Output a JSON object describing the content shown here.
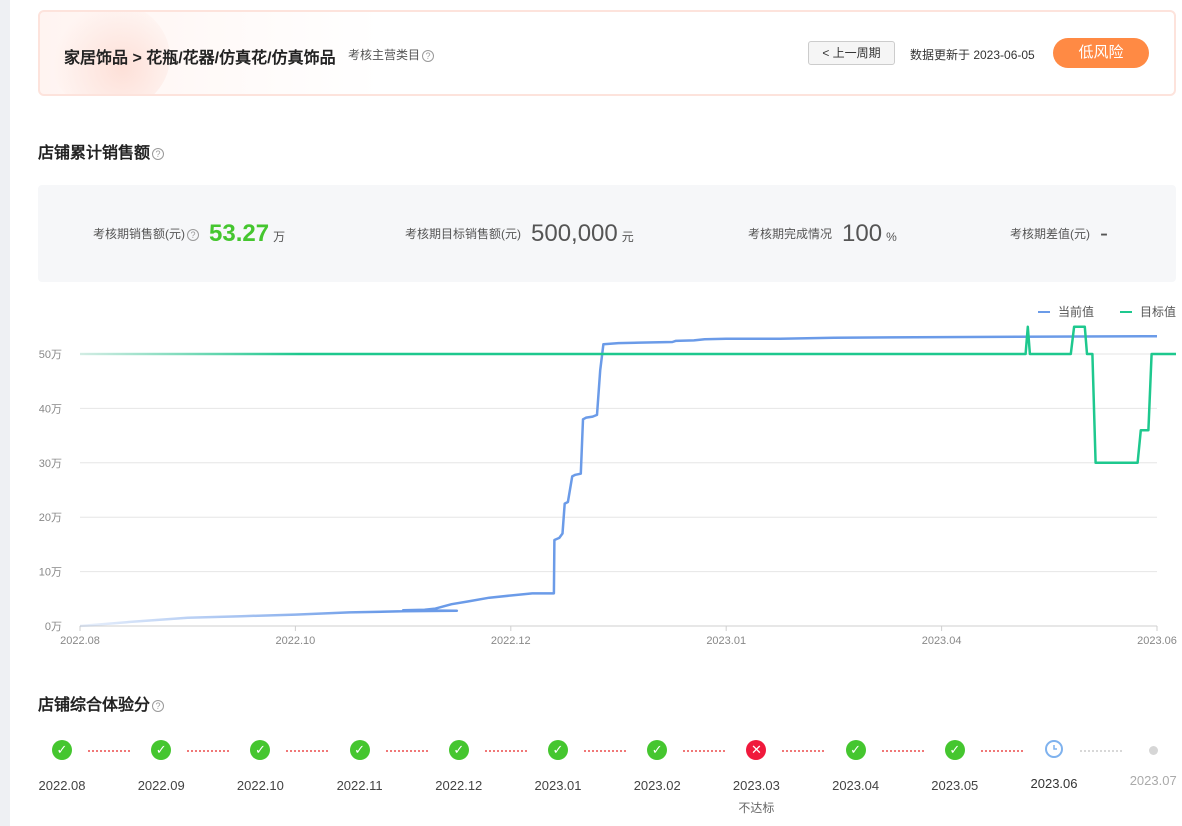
{
  "header": {
    "breadcrumb": "家居饰品 > 花瓶/花器/仿真花/仿真饰品",
    "category_note": "考核主营类目",
    "prev_button": "< 上一周期",
    "update_text": "数据更新于 2023-06-05",
    "risk_badge": "低风险",
    "risk_color": "#ff8a44"
  },
  "sales_section": {
    "title": "店铺累计销售额"
  },
  "stats": [
    {
      "label": "考核期销售额(元)",
      "value": "53.27",
      "unit": "万",
      "help": true,
      "highlight": true
    },
    {
      "label": "考核期目标销售额(元)",
      "value": "500,000",
      "unit": "元",
      "help": false,
      "highlight": false
    },
    {
      "label": "考核期完成情况",
      "value": "100",
      "unit": "%",
      "help": false,
      "highlight": false
    },
    {
      "label": "考核期差值(元)",
      "value": "-",
      "unit": "",
      "help": false,
      "highlight": false
    }
  ],
  "chart_data": {
    "type": "line",
    "y_unit": "万",
    "ylim": [
      0,
      50
    ],
    "y_ticks": [
      "0万",
      "10万",
      "20万",
      "30万",
      "40万",
      "50万"
    ],
    "x_ticks": [
      "2022.08",
      "2022.10",
      "2022.12",
      "2023.01",
      "2023.04",
      "2023.06"
    ],
    "grid": true,
    "legend": "top-right",
    "series": [
      {
        "name": "当前值",
        "color": "#6b9be8",
        "points": [
          [
            0,
            0
          ],
          [
            0.05,
            0.8
          ],
          [
            0.1,
            1.5
          ],
          [
            0.15,
            1.8
          ],
          [
            0.2,
            2.1
          ],
          [
            0.25,
            2.5
          ],
          [
            0.3,
            2.7
          ],
          [
            0.35,
            2.8
          ],
          [
            0.3,
            2.9
          ],
          [
            0.32,
            3.0
          ],
          [
            0.33,
            3.2
          ],
          [
            0.345,
            4.0
          ],
          [
            0.36,
            4.5
          ],
          [
            0.38,
            5.2
          ],
          [
            0.4,
            5.6
          ],
          [
            0.42,
            6.0
          ],
          [
            0.43,
            6.0
          ],
          [
            0.44,
            6.0
          ],
          [
            0.4405,
            15.8
          ],
          [
            0.445,
            16.2
          ],
          [
            0.448,
            17.0
          ],
          [
            0.45,
            22.5
          ],
          [
            0.453,
            22.8
          ],
          [
            0.457,
            27.5
          ],
          [
            0.46,
            27.8
          ],
          [
            0.465,
            28.0
          ],
          [
            0.467,
            38.0
          ],
          [
            0.47,
            38.3
          ],
          [
            0.476,
            38.5
          ],
          [
            0.48,
            38.8
          ],
          [
            0.483,
            47.0
          ],
          [
            0.486,
            51.8
          ],
          [
            0.5,
            52.0
          ],
          [
            0.52,
            52.1
          ],
          [
            0.55,
            52.2
          ],
          [
            0.553,
            52.4
          ],
          [
            0.57,
            52.5
          ],
          [
            0.58,
            52.7
          ],
          [
            0.6,
            52.8
          ],
          [
            0.65,
            52.8
          ],
          [
            0.7,
            53.0
          ],
          [
            0.8,
            53.1
          ],
          [
            0.9,
            53.2
          ],
          [
            1.0,
            53.27
          ]
        ]
      },
      {
        "name": "目标值",
        "color": "#1ec88e",
        "points": [
          [
            0,
            50
          ],
          [
            0.878,
            50
          ],
          [
            0.88,
            55
          ],
          [
            0.882,
            50
          ],
          [
            0.92,
            50
          ],
          [
            0.923,
            55
          ],
          [
            0.933,
            55
          ],
          [
            0.935,
            50
          ],
          [
            0.94,
            50
          ],
          [
            0.943,
            30
          ],
          [
            0.982,
            30
          ],
          [
            0.985,
            36
          ],
          [
            0.992,
            36
          ],
          [
            0.995,
            50
          ],
          [
            1.03,
            50
          ]
        ]
      }
    ]
  },
  "score_section": {
    "title": "店铺综合体验分"
  },
  "timeline": [
    {
      "month": "2022.08",
      "status": "pass",
      "note": ""
    },
    {
      "month": "2022.09",
      "status": "pass",
      "note": ""
    },
    {
      "month": "2022.10",
      "status": "pass",
      "note": ""
    },
    {
      "month": "2022.11",
      "status": "pass",
      "note": ""
    },
    {
      "month": "2022.12",
      "status": "pass",
      "note": ""
    },
    {
      "month": "2023.01",
      "status": "pass",
      "note": ""
    },
    {
      "month": "2023.02",
      "status": "pass",
      "note": ""
    },
    {
      "month": "2023.03",
      "status": "fail",
      "note": "不达标"
    },
    {
      "month": "2023.04",
      "status": "pass",
      "note": ""
    },
    {
      "month": "2023.05",
      "status": "pass",
      "note": ""
    },
    {
      "month": "2023.06",
      "status": "pending",
      "note": ""
    },
    {
      "month": "2023.07",
      "status": "future",
      "note": ""
    }
  ]
}
